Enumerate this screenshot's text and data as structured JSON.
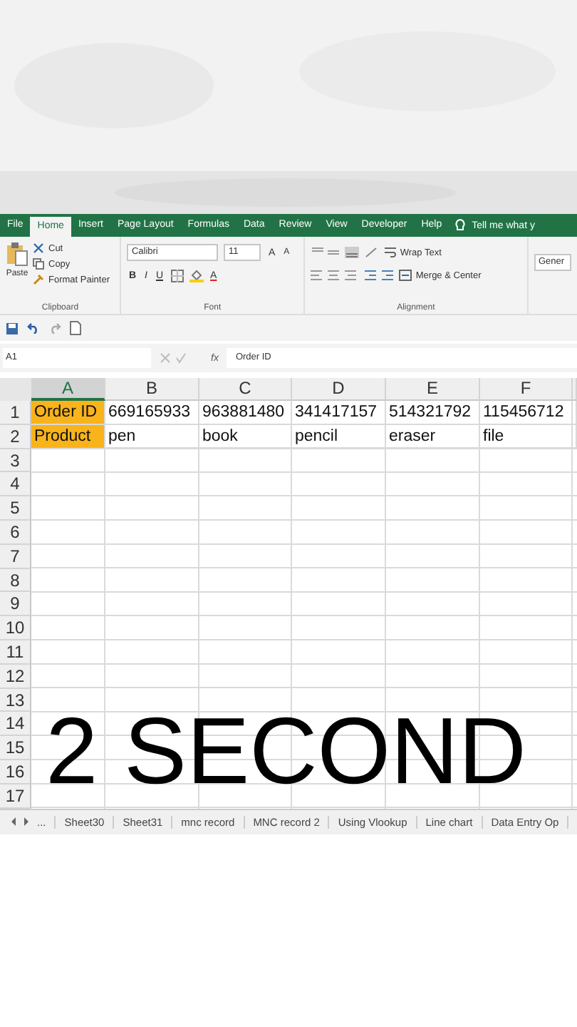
{
  "ribbon_tabs": [
    {
      "label": "File",
      "selected": false
    },
    {
      "label": "Home",
      "selected": true
    },
    {
      "label": "Insert",
      "selected": false
    },
    {
      "label": "Page Layout",
      "selected": false
    },
    {
      "label": "Formulas",
      "selected": false
    },
    {
      "label": "Data",
      "selected": false
    },
    {
      "label": "Review",
      "selected": false
    },
    {
      "label": "View",
      "selected": false
    },
    {
      "label": "Developer",
      "selected": false
    },
    {
      "label": "Help",
      "selected": false
    }
  ],
  "tell_me": "Tell me what y",
  "clipboard": {
    "paste": "Paste",
    "cut": "Cut",
    "copy": "Copy",
    "format_painter": "Format Painter",
    "label": "Clipboard"
  },
  "font": {
    "family": "Calibri",
    "size": "11",
    "bold": "B",
    "italic": "I",
    "underline": "U",
    "grow": "A",
    "shrink": "A",
    "color_button": "A",
    "label": "Font"
  },
  "alignment": {
    "wrap": "Wrap Text",
    "merge": "Merge & Center",
    "label": "Alignment"
  },
  "number": {
    "format": "Gener"
  },
  "name_box": "A1",
  "function_label": "fx",
  "formula": "Order ID",
  "columns": [
    {
      "label": "A",
      "selected": true
    },
    {
      "label": "B",
      "selected": false
    },
    {
      "label": "C",
      "selected": false
    },
    {
      "label": "D",
      "selected": false
    },
    {
      "label": "E",
      "selected": false
    },
    {
      "label": "F",
      "selected": false
    }
  ],
  "rows": [
    {
      "label": "1",
      "cells": [
        {
          "text": "Order ID",
          "highlighted": true
        },
        {
          "text": "669165933",
          "highlighted": false
        },
        {
          "text": "963881480",
          "highlighted": false
        },
        {
          "text": "341417157",
          "highlighted": false
        },
        {
          "text": "514321792",
          "highlighted": false
        },
        {
          "text": "115456712",
          "highlighted": false
        }
      ]
    },
    {
      "label": "2",
      "cells": [
        {
          "text": "Product",
          "highlighted": true
        },
        {
          "text": "pen",
          "highlighted": false
        },
        {
          "text": "book",
          "highlighted": false
        },
        {
          "text": "pencil",
          "highlighted": false
        },
        {
          "text": "eraser",
          "highlighted": false
        },
        {
          "text": "file",
          "highlighted": false
        }
      ]
    },
    {
      "label": "3"
    },
    {
      "label": "4"
    },
    {
      "label": "5"
    },
    {
      "label": "6"
    },
    {
      "label": "7"
    },
    {
      "label": "8"
    },
    {
      "label": "9"
    },
    {
      "label": "10"
    },
    {
      "label": "11"
    },
    {
      "label": "12"
    },
    {
      "label": "13"
    },
    {
      "label": "14"
    },
    {
      "label": "15"
    },
    {
      "label": "16"
    },
    {
      "label": "17"
    }
  ],
  "sheet_nav": "...",
  "sheets": [
    {
      "label": "Sheet30",
      "selected": false
    },
    {
      "label": "Sheet31",
      "selected": false
    },
    {
      "label": "mnc record",
      "selected": false
    },
    {
      "label": "MNC record 2",
      "selected": false
    },
    {
      "label": "Using Vlookup",
      "selected": false
    },
    {
      "label": "Line chart",
      "selected": false
    },
    {
      "label": "Data Entry Op",
      "selected": false
    }
  ],
  "caption": "2 SECOND"
}
